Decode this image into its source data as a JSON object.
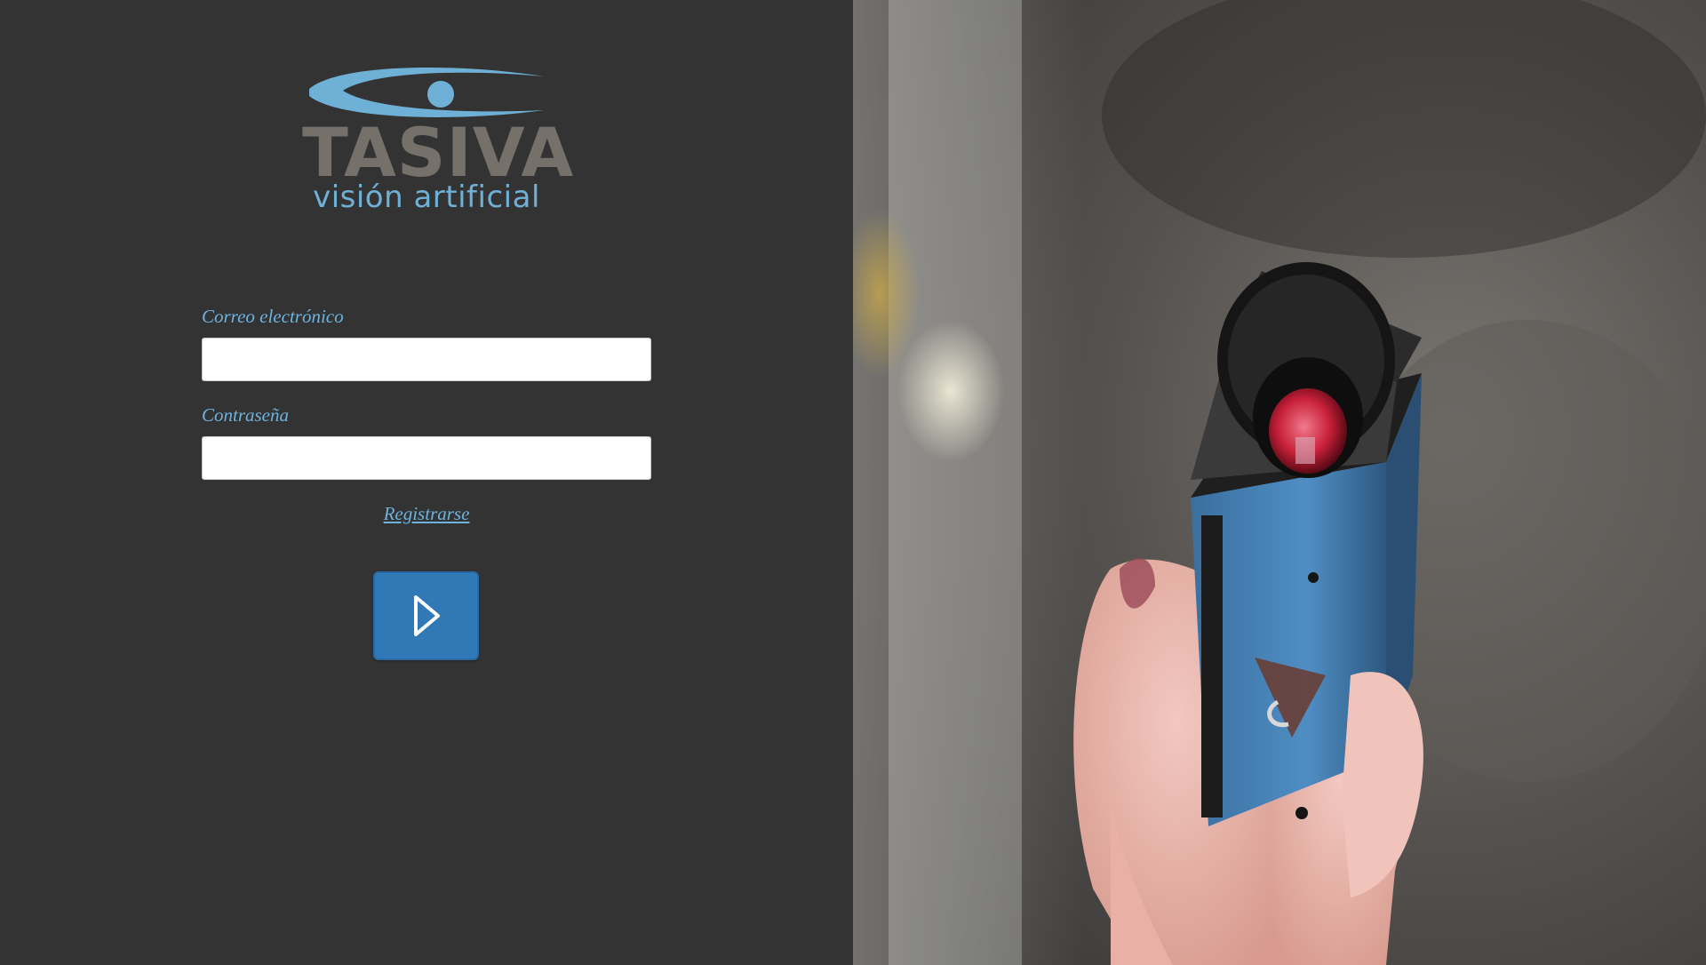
{
  "brand": {
    "name": "TASIVA",
    "tagline": "visión artificial",
    "accent_color": "#6fb0d6",
    "wordmark_color": "#76706a"
  },
  "login_form": {
    "email_label": "Correo electrónico",
    "email_value": "",
    "password_label": "Contraseña",
    "password_value": "",
    "register_link": "Registrarse",
    "submit_icon": "play-arrow-icon",
    "button_color": "#3178b7"
  },
  "hero": {
    "subject": "hand-holding-industrial-camera"
  }
}
